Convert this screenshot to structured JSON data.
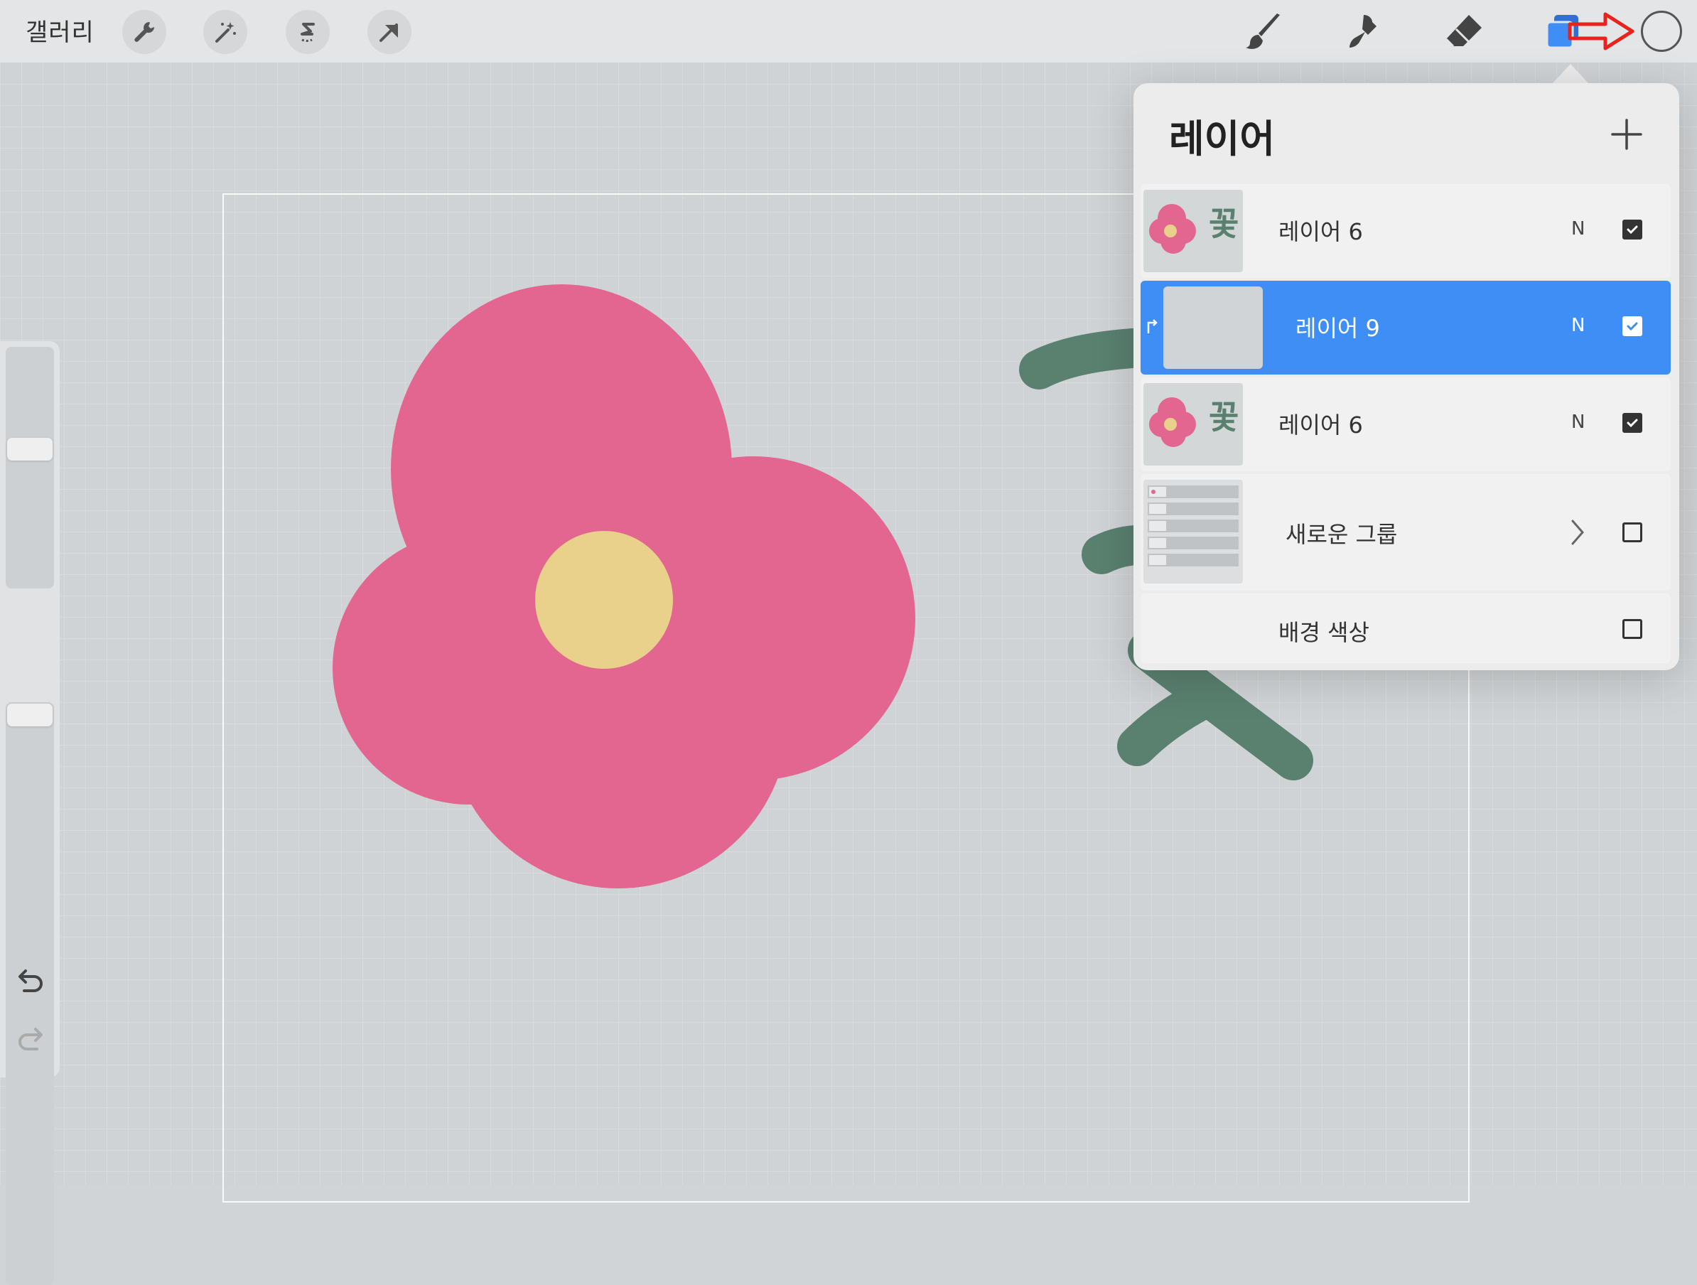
{
  "toolbar": {
    "gallery_label": "갤러리",
    "left_tools": [
      {
        "icon": "wrench-icon"
      },
      {
        "icon": "magic-wand-icon"
      },
      {
        "icon": "selection-icon"
      },
      {
        "icon": "transform-arrow-icon"
      }
    ],
    "right_tools": [
      {
        "icon": "brush-icon"
      },
      {
        "icon": "smudge-icon"
      },
      {
        "icon": "eraser-icon"
      },
      {
        "icon": "layers-icon"
      }
    ],
    "annotation_arrow_color": "#e8231d",
    "current_color": "#e6e7e8"
  },
  "sidebar": {
    "brush_size_level": 0.42,
    "opacity_level": 0.04,
    "modify_icon": "square-modify-icon",
    "undo_icon": "undo-icon",
    "redo_icon": "redo-icon"
  },
  "layers_panel": {
    "title": "레이어",
    "add_icon": "plus-icon",
    "layers": [
      {
        "name": "레이어 6",
        "blend": "N",
        "visible": true,
        "active": false,
        "thumb_text": "꽃"
      },
      {
        "name": "레이어 9",
        "blend": "N",
        "visible": true,
        "active": true
      },
      {
        "name": "레이어 6",
        "blend": "N",
        "visible": true,
        "active": false,
        "thumb_text": "꽃"
      },
      {
        "name": "새로운 그룹",
        "visible": false,
        "group": true
      },
      {
        "name": "배경 색상",
        "visible": false
      }
    ]
  },
  "colors": {
    "accent": "#3f8ef5",
    "petal": "#e2668f",
    "flower_center": "#e9d18c",
    "stroke_green": "#5a8070"
  }
}
